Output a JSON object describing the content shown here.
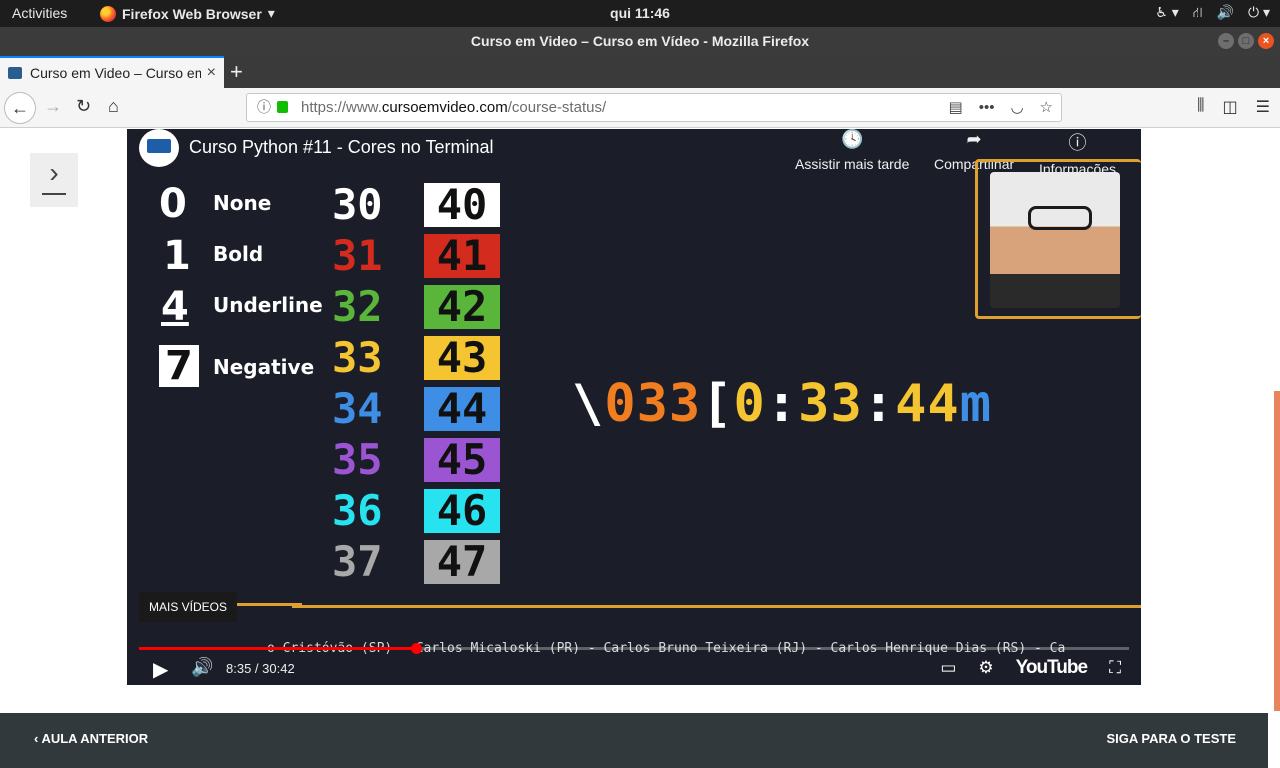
{
  "system": {
    "activities": "Activities",
    "app_name": "Firefox Web Browser",
    "clock": "qui 11:46"
  },
  "window": {
    "title": "Curso em Video – Curso em Vídeo - Mozilla Firefox"
  },
  "tab": {
    "title": "Curso em Video – Curso em Vídeo"
  },
  "address": {
    "prefix": "https://www.",
    "domain": "cursoemvideo.com",
    "path": "/course-status/"
  },
  "video": {
    "title": "Curso Python #11 - Cores no Terminal",
    "actions": {
      "watch_later": "Assistir mais tarde",
      "share": "Compartilhar",
      "info": "Informações"
    },
    "styles": [
      {
        "code": "0",
        "label": "None"
      },
      {
        "code": "1",
        "label": "Bold"
      },
      {
        "code": "4",
        "label": "Underline"
      },
      {
        "code": "7",
        "label": "Negative"
      }
    ],
    "fg_codes": [
      "30",
      "31",
      "32",
      "33",
      "34",
      "35",
      "36",
      "37"
    ],
    "bg_codes": [
      "40",
      "41",
      "42",
      "43",
      "44",
      "45",
      "46",
      "47"
    ],
    "colors": [
      "#ffffff",
      "#d32b1e",
      "#59b63b",
      "#f4c431",
      "#3f8ee6",
      "#9b55d2",
      "#27e3f0",
      "#a8a8a8"
    ],
    "sequence": {
      "p1": "\\",
      "p2": "033",
      "p3": "[",
      "p4": "0",
      "p5": ":",
      "p6": "33",
      "p7": ":",
      "p8": "44",
      "p9": "m"
    },
    "more_videos": "MAIS VÍDEOS",
    "ticker": "o Cristóvão (SP) - Carlos Micaloski (PR) - Carlos Bruno Teixeira (RJ) - Carlos Henrique Dias (RS) - Ca",
    "time": "8:35 / 30:42",
    "progress": 0.28,
    "brand": "YouTube"
  },
  "footer": {
    "prev": "AULA ANTERIOR",
    "next": "SIGA PARA O TESTE"
  }
}
